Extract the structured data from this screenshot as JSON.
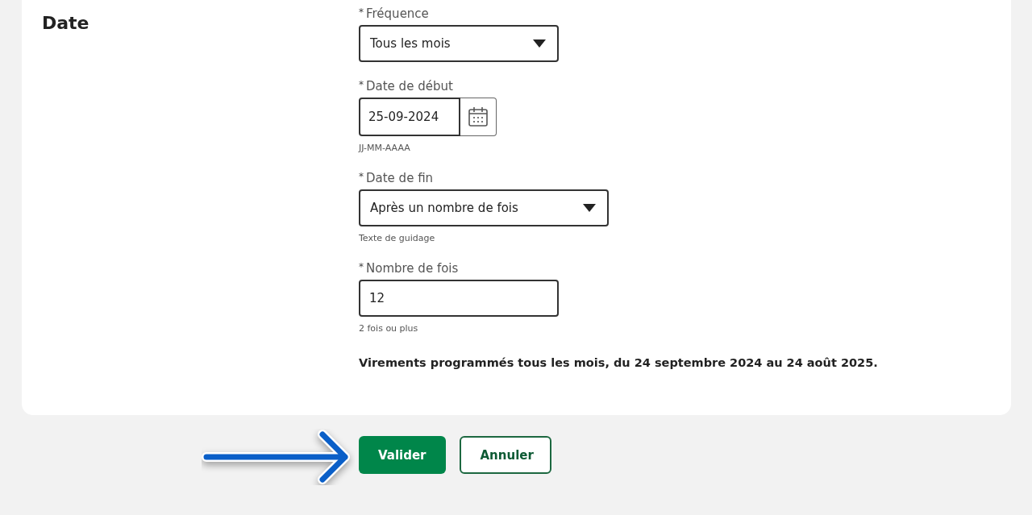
{
  "section": {
    "title": "Date"
  },
  "fields": [
    {
      "kind": "select",
      "required_mark": "*",
      "label": "Fréquence",
      "value": "Tous les mois"
    },
    {
      "kind": "date",
      "required_mark": "*",
      "label": "Date de début",
      "value": "25-09-2024",
      "hint": "JJ-MM-AAAA"
    },
    {
      "kind": "select",
      "required_mark": "*",
      "label": "Date de fin",
      "value": "Après un nombre de fois",
      "hint": "Texte de guidage"
    },
    {
      "kind": "text",
      "required_mark": "*",
      "label": "Nombre de fois",
      "value": "12",
      "hint": "2 fois ou plus"
    }
  ],
  "summary": "Virements programmés tous les mois, du 24 septembre 2024 au 24 août 2025.",
  "buttons": [
    {
      "label": "Valider",
      "kind": "primary"
    },
    {
      "label": "Annuler",
      "kind": "secondary"
    }
  ]
}
